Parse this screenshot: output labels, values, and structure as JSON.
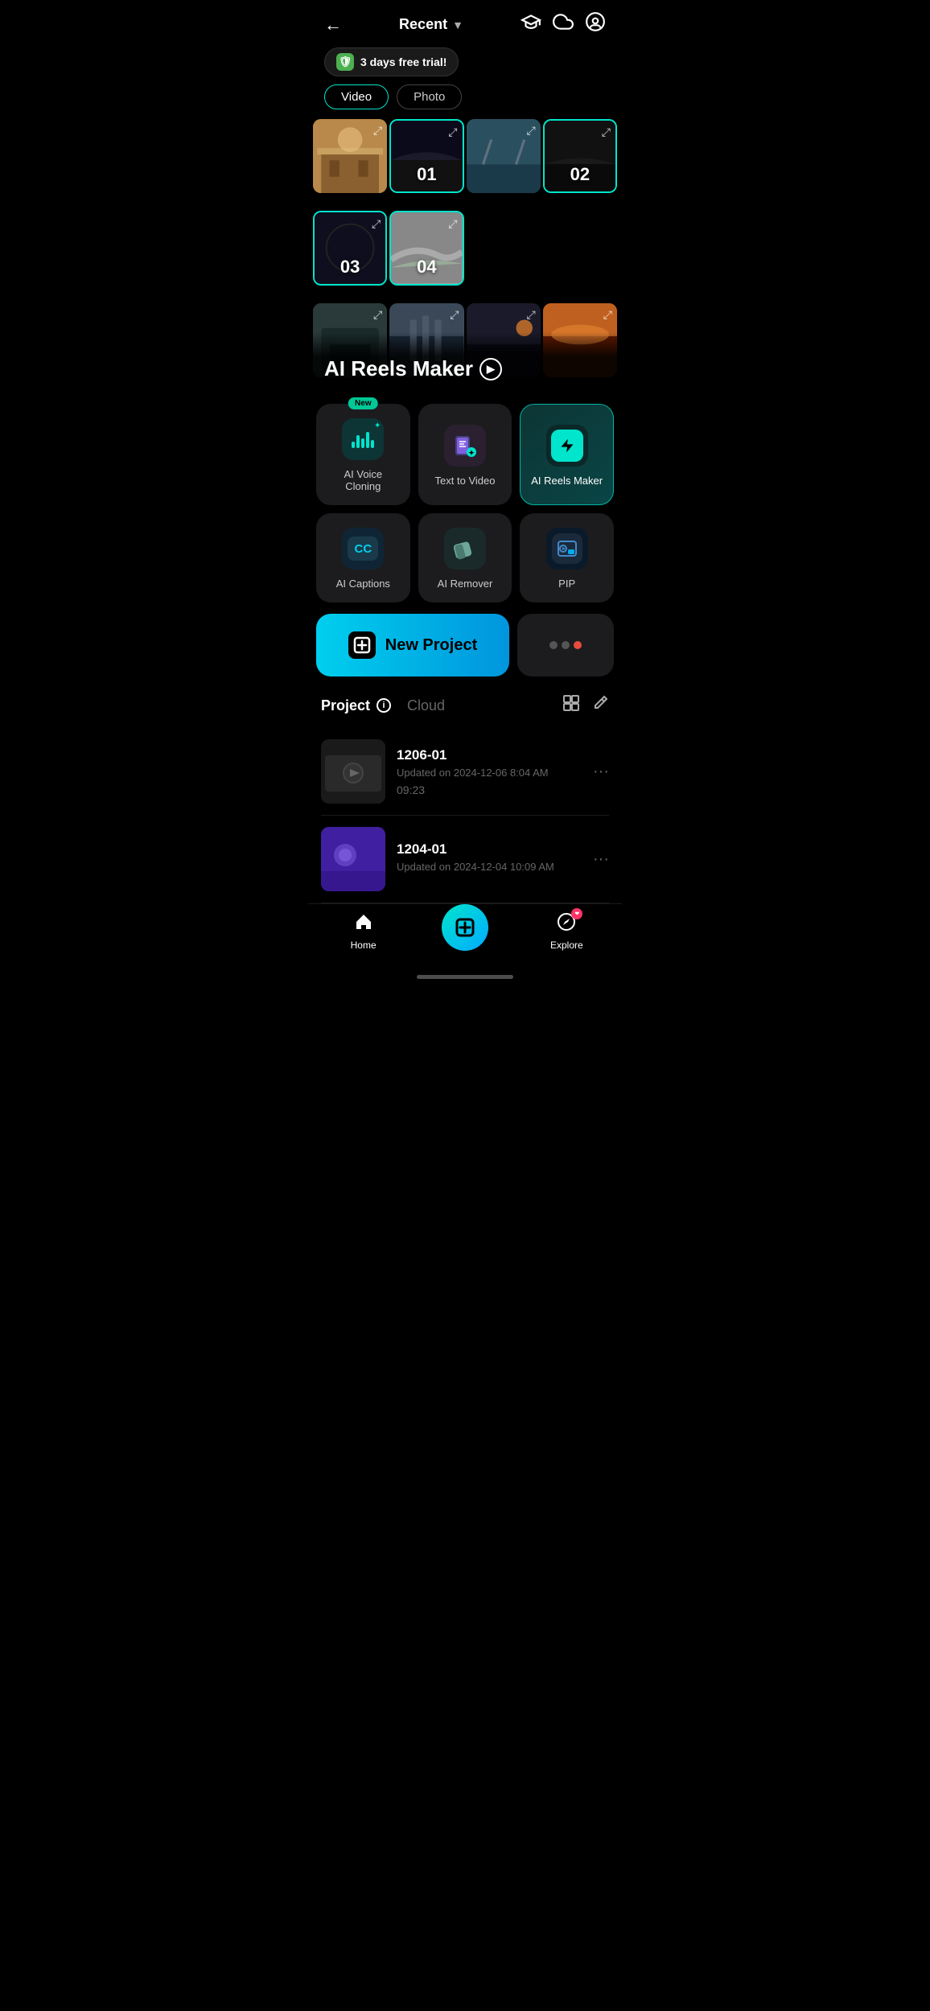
{
  "header": {
    "title": "Recent",
    "back_label": "←",
    "chevron": "▼"
  },
  "trial": {
    "label": "3 days free trial!",
    "icon": "🛡"
  },
  "filter_tabs": [
    {
      "label": "Video",
      "active": true
    },
    {
      "label": "Photo",
      "active": false
    }
  ],
  "media_grid": {
    "cells": [
      {
        "id": 1,
        "type": "photo",
        "css": "cell-1",
        "selected": false
      },
      {
        "id": 2,
        "type": "numbered",
        "number": "01",
        "css": "cell-2",
        "selected": true
      },
      {
        "id": 3,
        "type": "photo",
        "css": "cell-3",
        "selected": false
      },
      {
        "id": 4,
        "type": "numbered",
        "number": "02",
        "css": "cell-4",
        "selected": true
      },
      {
        "id": 5,
        "type": "numbered",
        "number": "03",
        "css": "cell-5",
        "selected": true
      },
      {
        "id": 6,
        "type": "numbered",
        "number": "04",
        "css": "cell-6",
        "selected": true
      },
      {
        "id": 7,
        "type": "photo",
        "css": "cell-7",
        "selected": false
      },
      {
        "id": 8,
        "type": "photo",
        "css": "cell-8",
        "selected": false
      },
      {
        "id": 9,
        "type": "photo",
        "css": "cell-9",
        "selected": false
      },
      {
        "id": 10,
        "type": "photo",
        "css": "cell-10",
        "selected": false
      },
      {
        "id": 11,
        "type": "photo",
        "css": "cell-11",
        "selected": false
      },
      {
        "id": 12,
        "type": "photo",
        "css": "cell-12",
        "selected": false
      }
    ]
  },
  "ai_reels_overlay": {
    "title": "AI Reels Maker"
  },
  "features": [
    {
      "id": "voice-cloning",
      "label": "AI Voice Cloning",
      "is_new": true,
      "highlighted": false
    },
    {
      "id": "text-to-video",
      "label": "Text  to Video",
      "is_new": false,
      "highlighted": false
    },
    {
      "id": "ai-reels",
      "label": "AI Reels Maker",
      "is_new": false,
      "highlighted": true
    },
    {
      "id": "ai-captions",
      "label": "AI Captions",
      "is_new": false,
      "highlighted": false
    },
    {
      "id": "ai-remover",
      "label": "AI Remover",
      "is_new": false,
      "highlighted": false
    },
    {
      "id": "pip",
      "label": "PIP",
      "is_new": false,
      "highlighted": false
    }
  ],
  "new_project": {
    "label": "New Project"
  },
  "more_dots": {
    "dots": [
      "inactive",
      "inactive",
      "active"
    ]
  },
  "project_section": {
    "project_tab": "Project",
    "cloud_tab": "Cloud",
    "info_symbol": "i"
  },
  "projects": [
    {
      "name": "1206-01",
      "updated": "Updated on 2024-12-06 8:04 AM",
      "duration": "09:23",
      "thumb_css": "thumb-1"
    },
    {
      "name": "1204-01",
      "updated": "Updated on 2024-12-04 10:09 AM",
      "duration": "",
      "thumb_css": "thumb-2"
    }
  ],
  "bottom_nav": {
    "home_label": "Home",
    "explore_label": "Explore"
  }
}
